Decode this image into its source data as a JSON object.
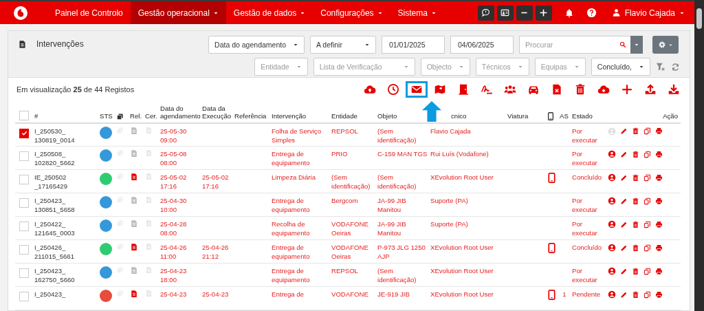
{
  "nav": {
    "menu": [
      {
        "label": "Painel de Controlo",
        "selected": false,
        "dropdown": false
      },
      {
        "label": "Gestão operacional",
        "selected": true,
        "dropdown": true
      },
      {
        "label": "Gestão de dados",
        "selected": false,
        "dropdown": true
      },
      {
        "label": "Configurações",
        "selected": false,
        "dropdown": true
      },
      {
        "label": "Sistema",
        "selected": false,
        "dropdown": true
      }
    ],
    "tools": [
      {
        "kind": "chat"
      },
      {
        "kind": "card"
      },
      {
        "kind": "minus"
      },
      {
        "kind": "plus"
      }
    ],
    "user": "Flavio Cajada"
  },
  "panel": {
    "title": "Intervenções",
    "filters_row_1": [
      {
        "kind": "select",
        "value": "Data do agendamento"
      },
      {
        "kind": "select",
        "value": "A definir"
      },
      {
        "kind": "date",
        "value": "01/01/2025"
      },
      {
        "kind": "date",
        "value": "04/06/2025"
      }
    ],
    "search": {
      "placeholder": "Procurar"
    },
    "filters_row_2": [
      {
        "placeholder": "Entidade"
      },
      {
        "placeholder": "Lista de Verificação"
      },
      {
        "placeholder": "Objecto"
      },
      {
        "placeholder": "Técnicos"
      },
      {
        "placeholder": "Equipas"
      },
      {
        "value": "Concluído,"
      }
    ]
  },
  "summary": "Em visualização **25** de 44 Registos",
  "toolbar": [
    {
      "kind": "cloud-upload",
      "highlighted": false
    },
    {
      "kind": "clock",
      "highlighted": false
    },
    {
      "kind": "envelope",
      "highlighted": true
    },
    {
      "kind": "map",
      "highlighted": false
    },
    {
      "kind": "door",
      "highlighted": false
    },
    {
      "kind": "signature",
      "highlighted": false
    },
    {
      "kind": "users",
      "highlighted": false
    },
    {
      "kind": "car",
      "highlighted": false
    },
    {
      "kind": "file-excel",
      "highlighted": false
    },
    {
      "kind": "trash",
      "highlighted": false
    },
    {
      "kind": "cloud-plus",
      "highlighted": false
    },
    {
      "kind": "plus",
      "highlighted": false
    },
    {
      "kind": "upload",
      "highlighted": false
    },
    {
      "kind": "download",
      "highlighted": false
    }
  ],
  "table": {
    "all_checked": false,
    "columns": [
      "#",
      "STS",
      "Rel.",
      "Cer.",
      "Data do agendamento",
      "Data da Execução",
      "Referência",
      "Intervenção",
      "Entidade",
      "Objeto",
      "cnico",
      "Viatura",
      "AS",
      "Estado",
      "Ação"
    ],
    "rows": [
      {
        "checked": true,
        "id": "I_250530_ 130819_0014",
        "color": "#3498db",
        "report": false,
        "scheduled": "25-05-30 09:00",
        "executed": "",
        "intervention": "Folha de Serviço Simples",
        "entity": "REPSOL",
        "object": "(Sem identificação)",
        "technician": "Flavio Cajada",
        "mobile": false,
        "as": "",
        "state": "Por executar",
        "assigned": false
      },
      {
        "checked": false,
        "id": "I_250508_ 102820_5662",
        "color": "#3498db",
        "report": false,
        "scheduled": "25-05-08 08:00",
        "executed": "",
        "intervention": "Entrega de equipamento",
        "entity": "PRIO",
        "object": "C-159 MAN TGS",
        "technician": "Rui Luís (Vodafone)",
        "mobile": false,
        "as": "",
        "state": "Por executar",
        "assigned": true
      },
      {
        "checked": false,
        "id": "IE_250502 _17165429",
        "color": "#2ecc71",
        "report": true,
        "scheduled": "25-05-02 17:16",
        "executed": "25-05-02 17:16",
        "intervention": "Limpeza Diária",
        "entity": "(Sem identificação)",
        "object": "(Sem identificação)",
        "technician": "XEvolution Root User",
        "mobile": true,
        "as": "",
        "state": "Concluído",
        "assigned": true
      },
      {
        "checked": false,
        "id": "I_250423_ 130851_5658",
        "color": "#3498db",
        "report": false,
        "scheduled": "25-04-30 10:00",
        "executed": "",
        "intervention": "Entrega de equipamento",
        "entity": "Bergcom",
        "object": "JA-99 JIB Manitou",
        "technician": "Suporte (PA)",
        "mobile": false,
        "as": "",
        "state": "Por executar",
        "assigned": true
      },
      {
        "checked": false,
        "id": "I_250422_ 121645_0003",
        "color": "#3498db",
        "report": false,
        "scheduled": "25-04-28 08:00",
        "executed": "",
        "intervention": "Recolha de equipamento",
        "entity": "VODAFONE Oeiras",
        "object": "JA-99 JIB Manitou",
        "technician": "Suporte (PA)",
        "mobile": false,
        "as": "",
        "state": "Por executar",
        "assigned": true
      },
      {
        "checked": false,
        "id": "I_250426_ 211015_5661",
        "color": "#2ecc71",
        "report": true,
        "scheduled": "25-04-26 11:00",
        "executed": "25-04-26 21:12",
        "intervention": "Entrega de equipamento",
        "entity": "VODAFONE Oeiras",
        "object": "P-973 JLG 1250 AJP",
        "technician": "XEvolution Root User",
        "mobile": true,
        "as": "",
        "state": "Concluído",
        "assigned": true
      },
      {
        "checked": false,
        "id": "I_250423_ 162750_5660",
        "color": "#3498db",
        "report": false,
        "scheduled": "25-04-23 18:00",
        "executed": "",
        "intervention": "Entrega de equipamento",
        "entity": "REPSOL",
        "object": "(Sem identificação)",
        "technician": "XEvolution Root User",
        "mobile": false,
        "as": "",
        "state": "Por executar",
        "assigned": true
      },
      {
        "checked": false,
        "id": "I_250423_",
        "color": "#e74c3c",
        "report": true,
        "scheduled": "25-04-23",
        "executed": "25-04-23",
        "intervention": "Entrega de",
        "entity": "VODAFONE",
        "object": "JE-919 JIB",
        "technician": "XEvolution Root User",
        "mobile": true,
        "as": "1",
        "state": "Pendente",
        "assigned": true
      }
    ]
  }
}
